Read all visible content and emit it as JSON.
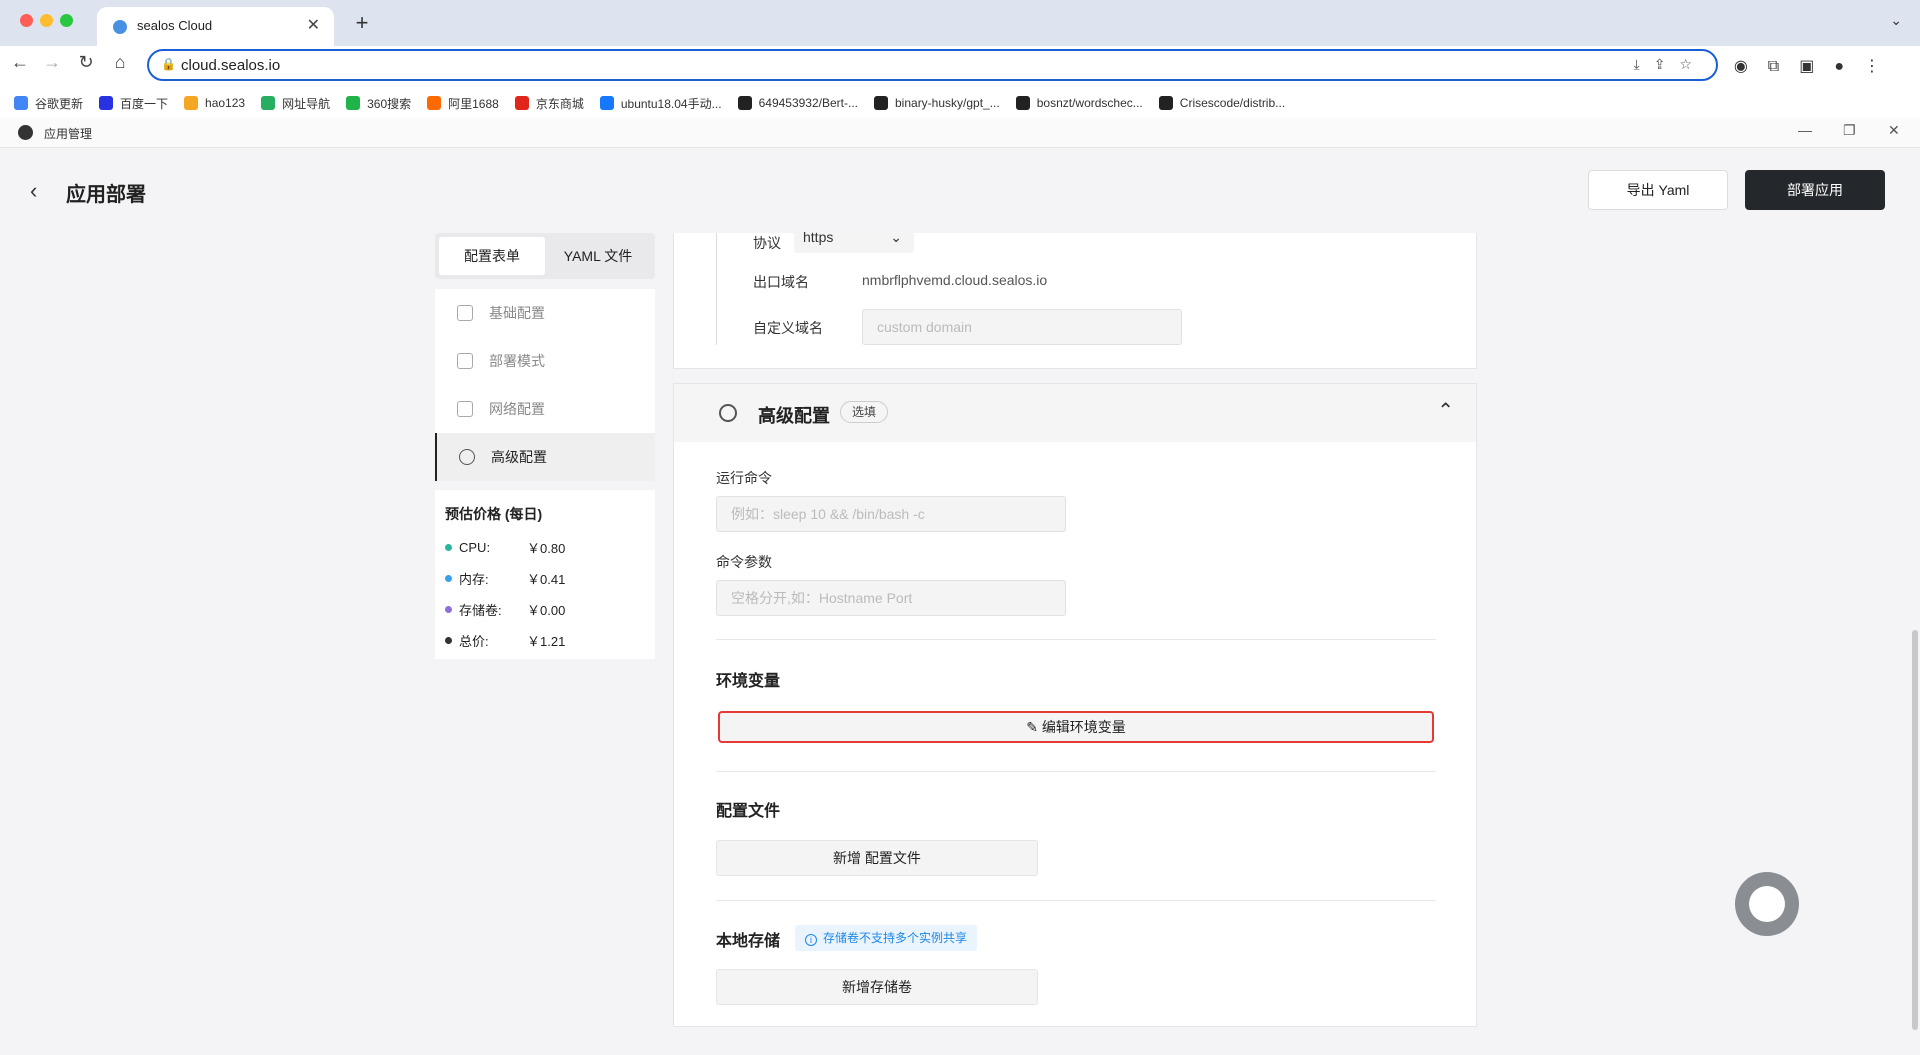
{
  "browser": {
    "tab_title": "sealos Cloud",
    "url": "cloud.sealos.io",
    "bookmarks": [
      {
        "label": "谷歌更新",
        "color": "#4285f4"
      },
      {
        "label": "百度一下",
        "color": "#2932e1"
      },
      {
        "label": "hao123",
        "color": "#f5a623"
      },
      {
        "label": "网址导航",
        "color": "#27ae60"
      },
      {
        "label": "360搜索",
        "color": "#1fb34a"
      },
      {
        "label": "阿里1688",
        "color": "#ff6a00"
      },
      {
        "label": "京东商城",
        "color": "#e1251b"
      },
      {
        "label": "ubuntu18.04手动...",
        "color": "#1677ff"
      },
      {
        "label": "649453932/Bert-...",
        "color": "#222222"
      },
      {
        "label": "binary-husky/gpt_...",
        "color": "#222222"
      },
      {
        "label": "bosnzt/wordschec...",
        "color": "#222222"
      },
      {
        "label": "Crisescode/distrib...",
        "color": "#222222"
      }
    ]
  },
  "app": {
    "window_title": "应用管理",
    "page_title": "应用部署",
    "export_button": "导出 Yaml",
    "deploy_button": "部署应用"
  },
  "left": {
    "tabs": [
      "配置表单",
      "YAML 文件"
    ],
    "nav": [
      {
        "label": "基础配置",
        "icon": "document-icon"
      },
      {
        "label": "部署模式",
        "icon": "cube-icon"
      },
      {
        "label": "网络配置",
        "icon": "network-icon"
      },
      {
        "label": "高级配置",
        "icon": "gear-icon"
      }
    ],
    "price": {
      "title": "预估价格 (每日)",
      "rows": [
        {
          "label": "CPU:",
          "value": "￥0.80",
          "color": "#2bb5a0"
        },
        {
          "label": "内存:",
          "value": "￥0.41",
          "color": "#36a2eb"
        },
        {
          "label": "存储卷:",
          "value": "￥0.00",
          "color": "#8e6fd8"
        },
        {
          "label": "总价:",
          "value": "￥1.21",
          "color": "#333333"
        }
      ]
    }
  },
  "network": {
    "protocol_label": "协议",
    "protocol_value": "https",
    "exit_domain_label": "出口域名",
    "exit_domain_value": "nmbrflphvemd.cloud.sealos.io",
    "custom_domain_label": "自定义域名",
    "custom_domain_placeholder": "custom domain"
  },
  "advanced": {
    "title": "高级配置",
    "tag": "选填",
    "run_cmd_label": "运行命令",
    "run_cmd_placeholder": "例如：sleep 10 && /bin/bash -c",
    "cmd_args_label": "命令参数",
    "cmd_args_placeholder": "空格分开,如：Hostname Port",
    "env_title": "环境变量",
    "env_button": "编辑环境变量",
    "config_title": "配置文件",
    "config_button": "新增 配置文件",
    "storage_title": "本地存储",
    "storage_tip": "存储卷不支持多个实例共享",
    "storage_button": "新增存储卷"
  }
}
